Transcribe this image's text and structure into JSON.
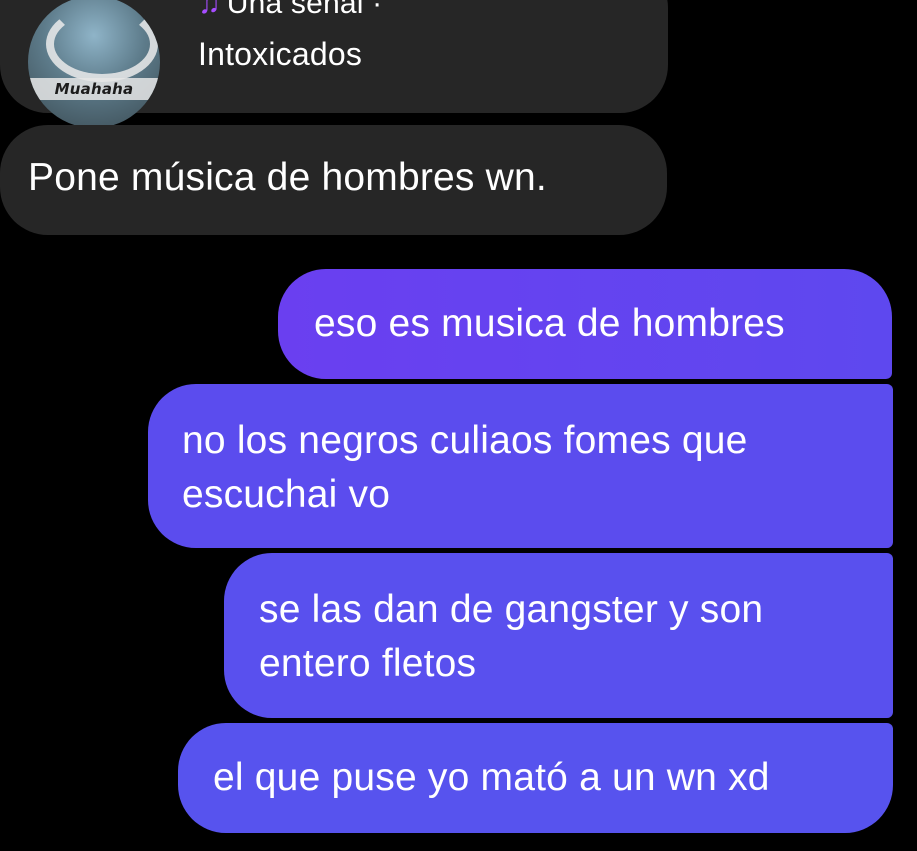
{
  "conversation": {
    "shared_music": {
      "album_art_text": "Muahaha",
      "music_icon": "music-note-icon",
      "song_title": "Una señal ·",
      "artist": "Intoxicados"
    },
    "messages": [
      {
        "direction": "incoming",
        "text": "Pone música de hombres wn."
      },
      {
        "direction": "outgoing",
        "text": "eso es musica de hombres"
      },
      {
        "direction": "outgoing",
        "text": "no los negros culiaos fomes que escuchai vo"
      },
      {
        "direction": "outgoing",
        "text": "se las dan de gangster y son entero fletos"
      },
      {
        "direction": "outgoing",
        "text": "el que puse yo mató a un wn xd"
      }
    ]
  },
  "colors": {
    "background": "#000000",
    "incoming_bubble": "#262626",
    "outgoing_bubble": "#5b4cee",
    "music_icon": "#a64dff"
  }
}
